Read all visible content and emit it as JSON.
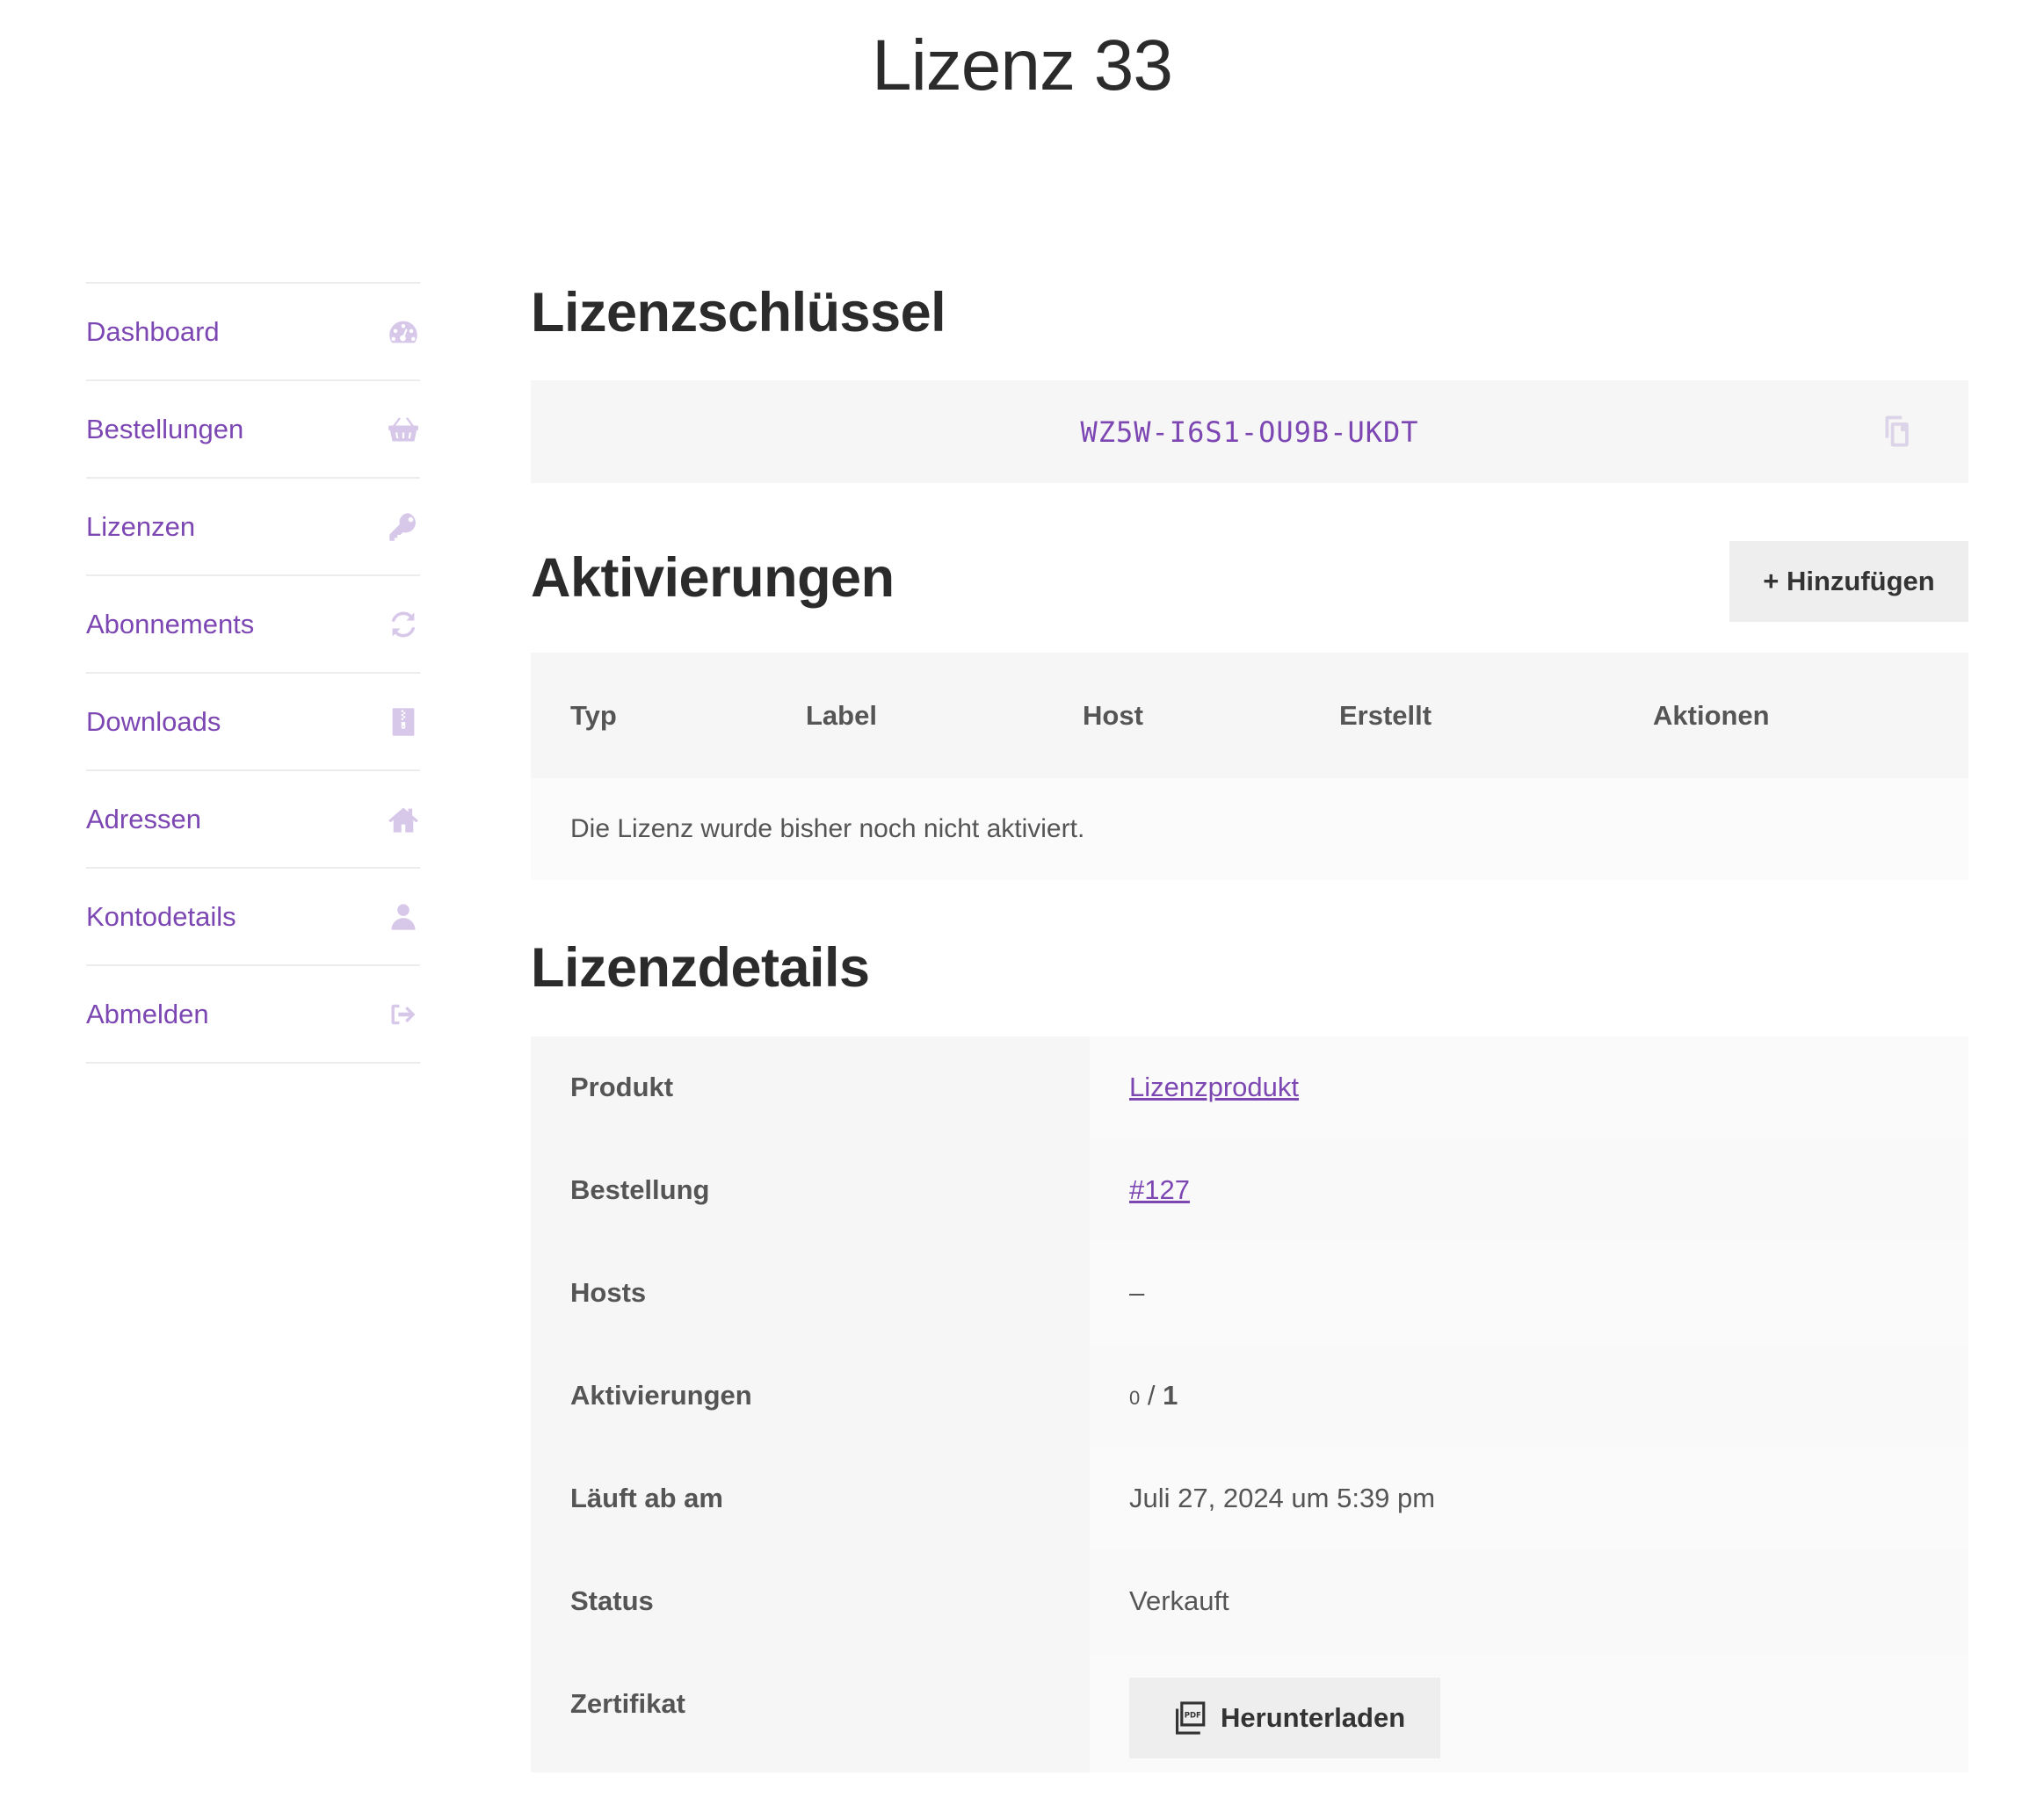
{
  "page": {
    "title": "Lizenz 33"
  },
  "sidebar": {
    "items": [
      {
        "label": "Dashboard",
        "icon": "dashboard-icon"
      },
      {
        "label": "Bestellungen",
        "icon": "basket-icon"
      },
      {
        "label": "Lizenzen",
        "icon": "key-icon"
      },
      {
        "label": "Abonnements",
        "icon": "refresh-icon"
      },
      {
        "label": "Downloads",
        "icon": "file-archive-icon"
      },
      {
        "label": "Adressen",
        "icon": "home-icon"
      },
      {
        "label": "Kontodetails",
        "icon": "user-icon"
      },
      {
        "label": "Abmelden",
        "icon": "sign-out-icon"
      }
    ]
  },
  "license_key": {
    "heading": "Lizenzschlüssel",
    "value": "WZ5W-I6S1-OU9B-UKDT",
    "copy_icon": "copy-icon"
  },
  "activations": {
    "heading": "Aktivierungen",
    "add_button": "+ Hinzufügen",
    "columns": [
      "Typ",
      "Label",
      "Host",
      "Erstellt",
      "Aktionen"
    ],
    "empty_message": "Die Lizenz wurde bisher noch nicht aktiviert."
  },
  "details": {
    "heading": "Lizenzdetails",
    "rows": {
      "product_label": "Produkt",
      "product_value": "Lizenzprodukt",
      "order_label": "Bestellung",
      "order_value": "#127",
      "hosts_label": "Hosts",
      "hosts_value": "–",
      "activations_label": "Aktivierungen",
      "activations_used": "0",
      "activations_sep": " / ",
      "activations_limit": "1",
      "expires_label": "Läuft ab am",
      "expires_value": "Juli 27, 2024 um 5:39 pm",
      "status_label": "Status",
      "status_value": "Verkauft",
      "certificate_label": "Zertifikat",
      "certificate_button": "Herunterladen",
      "certificate_icon": "pdf-icon"
    }
  },
  "colors": {
    "accent": "#7d47b3",
    "icon_muted": "#d7c8ea",
    "panel_bg": "#f6f6f6",
    "button_bg": "#eeeeee"
  }
}
